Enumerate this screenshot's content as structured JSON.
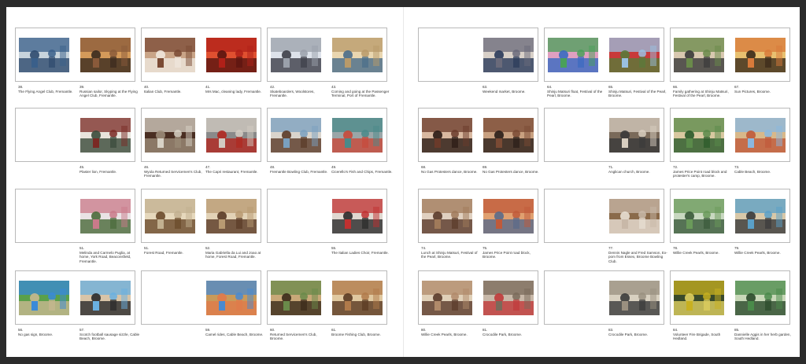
{
  "colors": {
    "background": "#2b2b2b",
    "sheet": "#ffffff",
    "frame": "#b9b9b9",
    "caption_text": "#333333"
  },
  "left_page": {
    "rows": [
      [
        {
          "photos": [
            {
              "num": "38.",
              "caption": "The Flying Angel Club, Fremantle.",
              "icon": "club-interior-photo",
              "colors": [
                "#3a5f8a",
                "#c8d4dc",
                "#2e4a6e"
              ]
            },
            {
              "num": "39.",
              "caption": "Russian sailor, Skyping at the Flying Angel Club, Fremantle.",
              "icon": "sailor-computer-photo",
              "colors": [
                "#8a5a3a",
                "#d49a5a",
                "#3a2a1e"
              ]
            }
          ]
        },
        {
          "photos": [
            {
              "num": "40.",
              "caption": "Italian Club, Fremantle.",
              "icon": "hall-interior-photo",
              "colors": [
                "#7a4a34",
                "#c9a487",
                "#efe7dd"
              ]
            },
            {
              "num": "41.",
              "caption": "Mrs Mac, cleaning lady, Fremantle.",
              "icon": "red-curtain-photo",
              "colors": [
                "#b02018",
                "#e05030",
                "#5a1410"
              ]
            }
          ]
        },
        {
          "photos": [
            {
              "num": "42.",
              "caption": "Skateboarders, Woolstores, Fremantle.",
              "icon": "skate-park-photo",
              "colors": [
                "#9aa0aa",
                "#dde2ea",
                "#3d3f48"
              ]
            },
            {
              "num": "43.",
              "caption": "Coming and going at the Passenger Terminal, Port of Fremantle.",
              "icon": "terminal-photo",
              "colors": [
                "#b89a6a",
                "#e9d6b0",
                "#4a6d8a"
              ]
            }
          ]
        }
      ],
      [
        {
          "photos": [
            {
              "num": "45.",
              "caption": "Plaster lion, Fremantle.",
              "icon": "lion-statue-photo",
              "colors": [
                "#7a2a24",
                "#e8e4dc",
                "#3a4a3a"
              ]
            }
          ]
        },
        {
          "photos": [
            {
              "num": "46.",
              "caption": "Wyola Returned Servicemen's Club, Fremantle.",
              "icon": "wall-lamp-photo",
              "colors": [
                "#d8d2c6",
                "#4a2e22",
                "#9b8b78"
              ]
            },
            {
              "num": "47.",
              "caption": "The Capri restaurant, Fremantle.",
              "icon": "restaurant-window-photo",
              "colors": [
                "#d2cbc2",
                "#8a8a8a",
                "#b02820"
              ]
            }
          ]
        },
        {
          "photos": [
            {
              "num": "48.",
              "caption": "Fremantle Bowling Club, Fremantle.",
              "icon": "bowling-club-photo",
              "colors": [
                "#7aa0c0",
                "#d9d4cc",
                "#5a3a28"
              ]
            },
            {
              "num": "49.",
              "caption": "Cicerello's Fish and Chips, Fremantle.",
              "icon": "fish-shop-photo",
              "colors": [
                "#4a8a8a",
                "#9aa6a8",
                "#c84a3a"
              ]
            }
          ]
        }
      ],
      [
        {
          "photos": [
            {
              "num": "51.",
              "caption": "Melinda and Carmelo Puglia, at home, York Road, Beaconsfield, Fremantle.",
              "icon": "couple-porch-photo",
              "colors": [
                "#c97a8a",
                "#e9e2e4",
                "#4a6a3a"
              ]
            }
          ]
        },
        {
          "photos": [
            {
              "num": "51.",
              "caption": "Forest Road, Fremantle.",
              "icon": "living-room-photo",
              "colors": [
                "#c2b090",
                "#e6d8bc",
                "#6a4a2a"
              ]
            },
            {
              "num": "52.",
              "caption": "Maria Gabriella da Lui and Joao at home, Forest Road, Fremantle.",
              "icon": "couple-sofa-photo",
              "colors": [
                "#b89a72",
                "#e2d2b6",
                "#5a3a26"
              ]
            }
          ]
        },
        {
          "photos": [
            {
              "num": "55.",
              "caption": "The Italian Ladies Choir, Fremantle.",
              "icon": "choir-photo",
              "colors": [
                "#c03030",
                "#e0d8d0",
                "#2a2a2a"
              ]
            }
          ]
        }
      ],
      [
        {
          "photos": [
            {
              "num": "56.",
              "caption": "No gas sign, Broome.",
              "icon": "protest-sign-photo",
              "colors": [
                "#3a8ad8",
                "#5aa04a",
                "#c8b890"
              ]
            },
            {
              "num": "57.",
              "caption": "Scotch football sausage sizzle, Cable Beach, Broome.",
              "icon": "beach-bbq-photo",
              "colors": [
                "#6ab0e0",
                "#d8c4a8",
                "#2a2a2a"
              ]
            }
          ]
        },
        {
          "photos": [
            {
              "num": "59.",
              "caption": "Camel rides, Cable Beach, Broome.",
              "icon": "camel-rides-photo",
              "colors": [
                "#4a8ad0",
                "#c89a5a",
                "#e07a4a"
              ]
            }
          ]
        },
        {
          "photos": [
            {
              "num": "60.",
              "caption": "Returned Servicemen's Club, Broome.",
              "icon": "rsl-club-photo",
              "colors": [
                "#6a8a4a",
                "#c8a878",
                "#3a2a1a"
              ]
            },
            {
              "num": "61.",
              "caption": "Broome Fishing Club, Broome.",
              "icon": "fishing-club-photo",
              "colors": [
                "#b07a4a",
                "#e0c8a0",
                "#5a3a22"
              ]
            }
          ]
        }
      ]
    ]
  },
  "right_page": {
    "rows": [
      [
        {
          "photos": [
            {
              "num": "63.",
              "caption": "Weekend market, Broome.",
              "icon": "market-photo",
              "colors": [
                "#6a6a7a",
                "#d8d0c8",
                "#2a3a5a"
              ]
            }
          ]
        },
        {
          "photos": [
            {
              "num": "64.",
              "caption": "Shinju Matsuri float, Festival of the Pearl, Broome.",
              "icon": "parade-float-photo",
              "colors": [
                "#4aa05a",
                "#e0a0c0",
                "#3a6ac0"
              ]
            },
            {
              "num": "65.",
              "caption": "Shinju Matsuri, Festival of the Pearl, Broome.",
              "icon": "festival-crowd-photo",
              "colors": [
                "#9ac0e0",
                "#c83a3a",
                "#5a7a3a"
              ]
            }
          ]
        },
        {
          "photos": [
            {
              "num": "66.",
              "caption": "Family gathering at Shinju Matsuri, Festival of the Pearl, Broome.",
              "icon": "family-picnic-photo",
              "colors": [
                "#6a8a4a",
                "#d8c8b0",
                "#3a3a3a"
              ]
            },
            {
              "num": "67.",
              "caption": "Sun Pictures, Broome.",
              "icon": "cinema-crowd-photo",
              "colors": [
                "#d87a3a",
                "#e8c070",
                "#3a2a1a"
              ]
            }
          ]
        }
      ],
      [
        {
          "photos": [
            {
              "num": "68.",
              "caption": "No Gas Protesters dance, Broome.",
              "icon": "dance-photo",
              "colors": [
                "#6a3a2a",
                "#d8b8a0",
                "#2a1a14"
              ]
            },
            {
              "num": "69.",
              "caption": "No Gas Protesters dance, Broome.",
              "icon": "dance-crowd-photo",
              "colors": [
                "#7a4a34",
                "#c8a080",
                "#2a1e18"
              ]
            }
          ]
        },
        {
          "photos": [
            {
              "num": "71.",
              "caption": "Anglican church, Broome.",
              "icon": "church-interior-photo",
              "colors": [
                "#d8cec0",
                "#7a6a5a",
                "#3a3a3a"
              ]
            }
          ]
        },
        {
          "photos": [
            {
              "num": "72.",
              "caption": "James Price Point road block and protester's camp, Broome.",
              "icon": "road-camp-photo",
              "colors": [
                "#5a8a4a",
                "#d8c8a0",
                "#2a5a2a"
              ]
            },
            {
              "num": "73.",
              "caption": "Cable Beach, Broome.",
              "icon": "beach-people-photo",
              "colors": [
                "#8ab8e0",
                "#d8b88a",
                "#c05a3a"
              ]
            }
          ]
        }
      ],
      [
        {
          "photos": [
            {
              "num": "74.",
              "caption": "Lunch at Shinju Matsuri, Festival of the Pearl, Broome.",
              "icon": "lunch-table-photo",
              "colors": [
                "#a07a5a",
                "#e0d0c0",
                "#5a3a2a"
              ]
            },
            {
              "num": "75.",
              "caption": "James Price Point road block, Broome.",
              "icon": "roadblock-photo",
              "colors": [
                "#c05a3a",
                "#e0a070",
                "#5a6a8a"
              ]
            }
          ]
        },
        {
          "photos": [
            {
              "num": "77.",
              "caption": "Dennis Nagle and Fred Samson, Ex-pom from Essex, Broome Bowling Club.",
              "icon": "bar-interior-photo",
              "colors": [
                "#c8b8a8",
                "#8a6a4a",
                "#e8e0d4"
              ]
            }
          ]
        },
        {
          "photos": [
            {
              "num": "78.",
              "caption": "Willie Creek Pearls, Broome.",
              "icon": "pearl-farm-photo",
              "colors": [
                "#6a9a5a",
                "#c8d8c0",
                "#3a5a3a"
              ]
            },
            {
              "num": "79.",
              "caption": "Willie Creek Pearls, Broome.",
              "icon": "boat-tour-photo",
              "colors": [
                "#5aa0c8",
                "#d8c8a8",
                "#3a3a3a"
              ]
            }
          ]
        }
      ],
      [
        {
          "photos": [
            {
              "num": "80.",
              "caption": "Willie Creek Pearls, Broome.",
              "icon": "dining-group-photo",
              "colors": [
                "#b08a6a",
                "#e0d0b8",
                "#5a3a2a"
              ]
            },
            {
              "num": "81.",
              "caption": "Crocodile Park, Broome.",
              "icon": "croc-park-photo",
              "colors": [
                "#7a6a5a",
                "#c8b8a8",
                "#c03a3a"
              ]
            }
          ]
        },
        {
          "photos": [
            {
              "num": "83.",
              "caption": "Crocodile Park, Broome.",
              "icon": "croc-keeper-photo",
              "colors": [
                "#9a9080",
                "#d8d0c0",
                "#3a3a3a"
              ]
            }
          ]
        },
        {
          "photos": [
            {
              "num": "84.",
              "caption": "Volunteer Fire Brigade, South Hedland.",
              "icon": "fire-brigade-photo",
              "colors": [
                "#c8b020",
                "#3a4a2a",
                "#e0d060"
              ]
            },
            {
              "num": "85.",
              "caption": "Dannielle Aggis in her herb garden, South Hedland.",
              "icon": "herb-garden-photo",
              "colors": [
                "#4a8a4a",
                "#c8d8b8",
                "#2a4a2a"
              ]
            }
          ]
        }
      ]
    ]
  }
}
